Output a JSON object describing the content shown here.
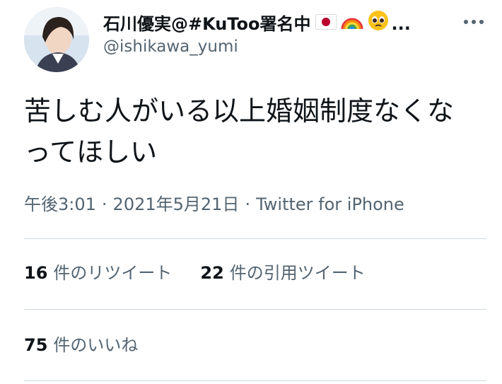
{
  "author": {
    "display_name": "石川優実@#KuToo署名中",
    "truncation": "...",
    "handle": "@ishikawa_yumi",
    "badges": [
      "flag-japan-icon",
      "rainbow-icon",
      "pleading-face-icon"
    ]
  },
  "tweet": {
    "text": "苦しむ人がいる以上婚姻制度なくなってほしい"
  },
  "meta": {
    "time": "午後3:01",
    "separator": "·",
    "date": "2021年5月21日",
    "source": "Twitter for iPhone"
  },
  "stats": {
    "retweets_count": "16",
    "retweets_label": "件のリツイート",
    "quotes_count": "22",
    "quotes_label": "件の引用ツイート",
    "likes_count": "75",
    "likes_label": "件のいいね"
  },
  "colors": {
    "text_primary": "#0f1419",
    "text_secondary": "#536471",
    "divider": "#cfd9de",
    "flag_red": "#bc002d"
  }
}
